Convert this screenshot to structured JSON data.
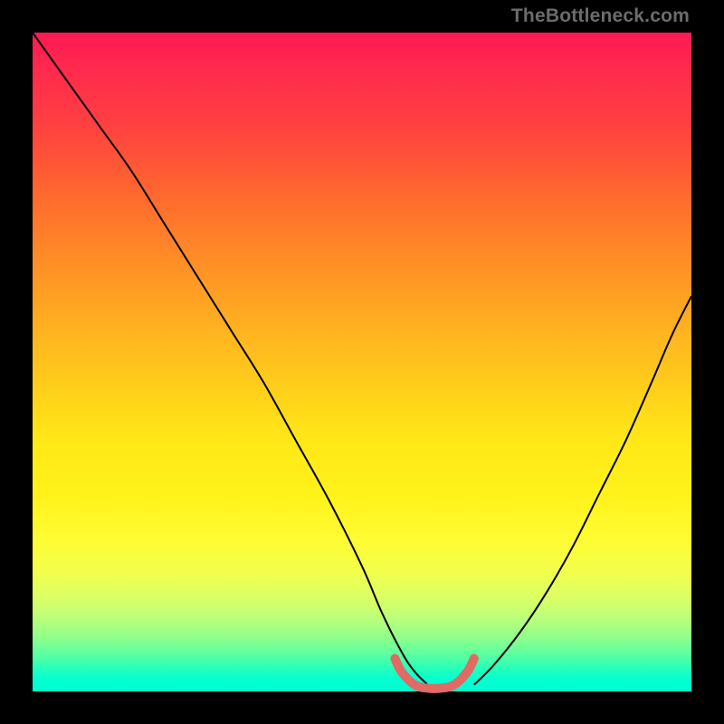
{
  "watermark": "TheBottleneck.com",
  "colors": {
    "curve": "#000000",
    "floor_marker": "#e06a64",
    "background": "#000000"
  },
  "chart_data": {
    "type": "line",
    "title": "",
    "xlabel": "",
    "ylabel": "",
    "xlim": [
      0,
      100
    ],
    "ylim": [
      0,
      100
    ],
    "grid": false,
    "legend": false,
    "series": [
      {
        "name": "left-descending-curve",
        "x": [
          0,
          5,
          10,
          15,
          20,
          25,
          30,
          35,
          40,
          45,
          50,
          53,
          56,
          58,
          60
        ],
        "values": [
          100,
          93,
          86,
          79,
          71,
          63,
          55,
          47,
          38,
          29,
          19,
          12,
          6,
          3,
          1
        ]
      },
      {
        "name": "right-ascending-curve",
        "x": [
          67,
          70,
          74,
          78,
          82,
          86,
          90,
          94,
          97,
          100
        ],
        "values": [
          1,
          4,
          9,
          15,
          22,
          30,
          38,
          47,
          54,
          60
        ]
      },
      {
        "name": "floor-marker",
        "x": [
          55,
          56,
          58,
          60,
          62,
          64,
          66,
          67
        ],
        "values": [
          5,
          3,
          1,
          0.5,
          0.5,
          1,
          3,
          5
        ]
      }
    ],
    "gradient_stops": [
      {
        "offset": 0.0,
        "color": "#ff1a53"
      },
      {
        "offset": 0.25,
        "color": "#ff6a2e"
      },
      {
        "offset": 0.55,
        "color": "#ffd21a"
      },
      {
        "offset": 0.8,
        "color": "#f2ff4d"
      },
      {
        "offset": 0.95,
        "color": "#4dffa6"
      },
      {
        "offset": 1.0,
        "color": "#00ffc8"
      }
    ]
  }
}
